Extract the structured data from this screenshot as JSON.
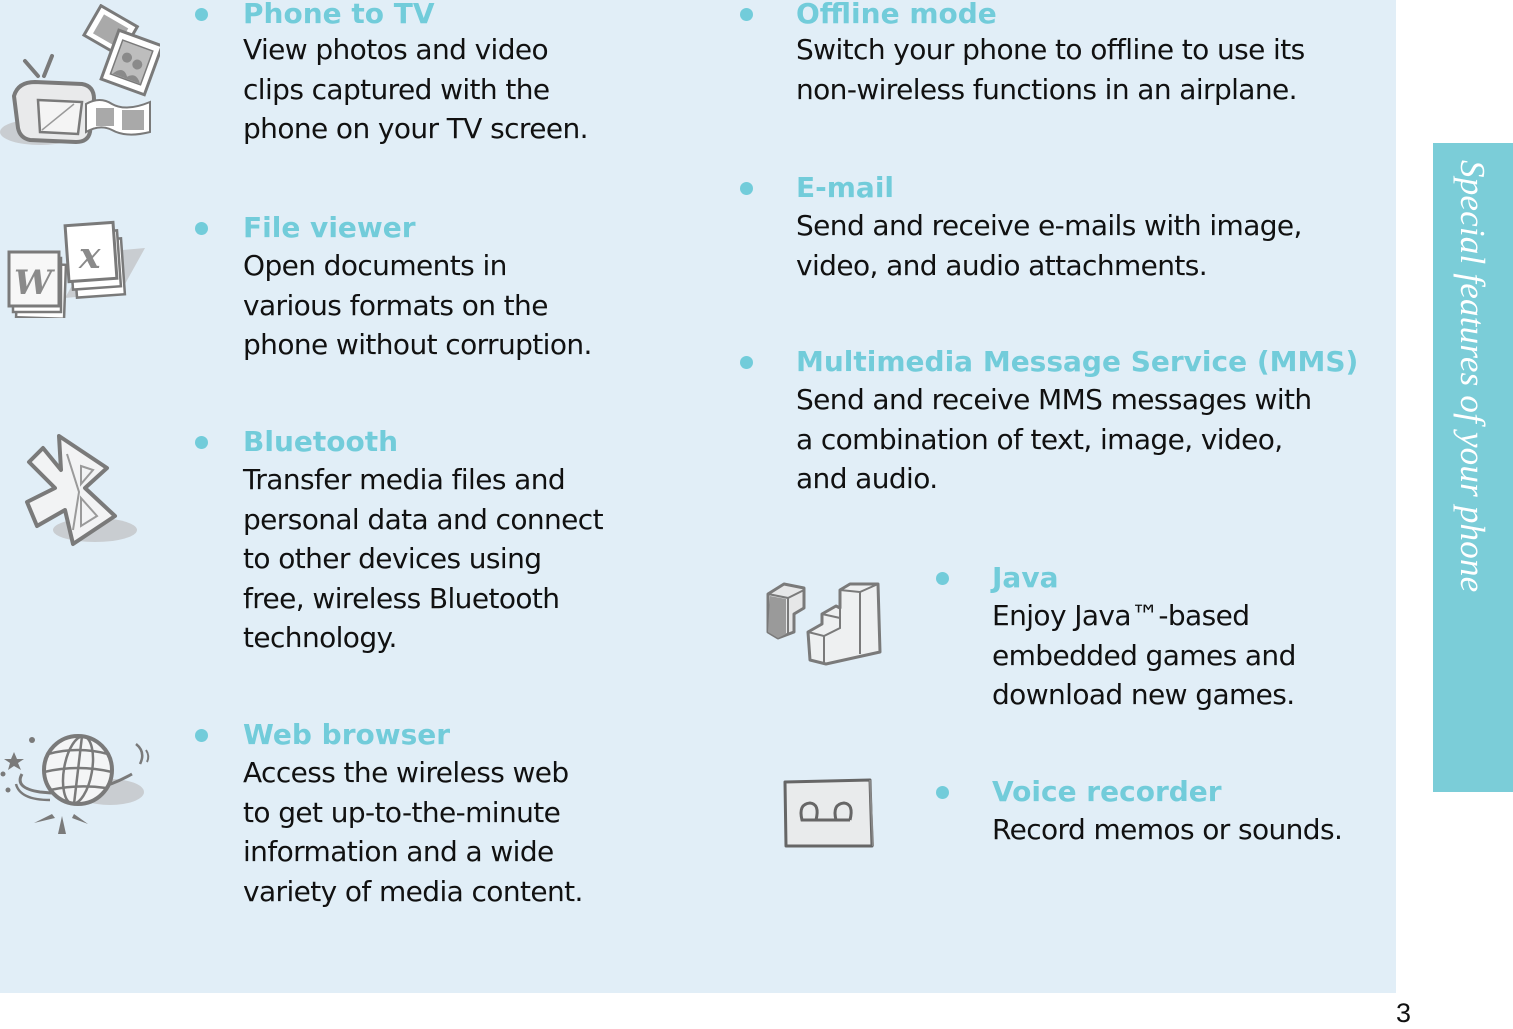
{
  "page": {
    "section_tab": "Special features of your phone",
    "page_number": "3",
    "colors": {
      "panel_background": "#e1eef7",
      "tab_background": "#7bcdd8",
      "heading_accent": "#72ccda",
      "body_text": "#111111"
    }
  },
  "left_column": {
    "features": [
      {
        "icon": "tv-photos-icon",
        "title": "Phone to TV",
        "lines": [
          "View photos and video",
          "clips captured with the",
          "phone on your TV screen."
        ]
      },
      {
        "icon": "document-files-icon",
        "title": "File viewer",
        "lines": [
          "Open documents in",
          "various formats on the",
          "phone without corruption."
        ]
      },
      {
        "icon": "bluetooth-icon",
        "title": "Bluetooth",
        "lines": [
          "Transfer media files and",
          "personal data and connect",
          "to other devices using",
          "free, wireless Bluetooth",
          "technology."
        ]
      },
      {
        "icon": "globe-icon",
        "title": "Web browser",
        "lines": [
          "Access the wireless web",
          "to get up-to-the-minute",
          "information and a wide",
          "variety of media content."
        ]
      }
    ]
  },
  "right_column": {
    "features": [
      {
        "title": "Offline mode",
        "lines": [
          "Switch your phone to offline to use its",
          "non-wireless functions in an airplane."
        ]
      },
      {
        "title": "E-mail",
        "lines": [
          "Send and receive e-mails with image,",
          "video, and audio attachments."
        ]
      },
      {
        "title": "Multimedia Message Service (MMS)",
        "lines": [
          "Send and receive MMS messages with",
          "a combination of text, image, video,",
          "and audio."
        ]
      },
      {
        "icon": "game-blocks-icon",
        "title": "Java",
        "lines": [
          "Enjoy Java™-based",
          "embedded games and",
          "download new games."
        ]
      },
      {
        "icon": "voicemail-tape-icon",
        "title": "Voice recorder",
        "lines": [
          "Record memos or sounds."
        ]
      }
    ]
  }
}
